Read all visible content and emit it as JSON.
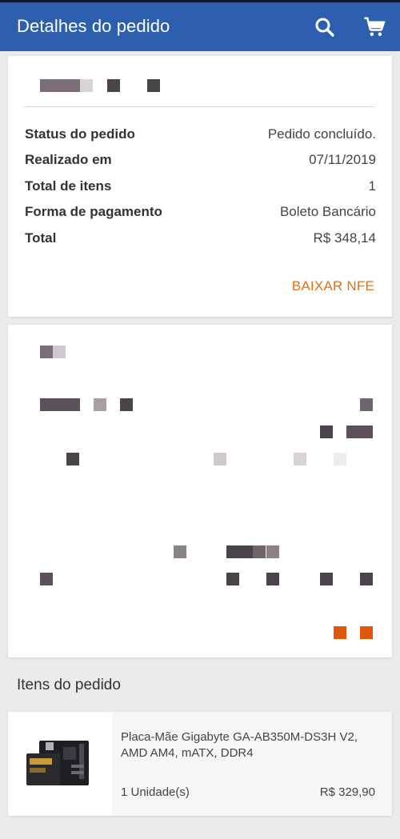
{
  "appbar": {
    "title": "Detalhes do pedido",
    "icons": [
      "search-icon",
      "cart-icon"
    ],
    "color": "#2d5fae"
  },
  "summary": {
    "rows": [
      {
        "label": "Status do pedido",
        "value": "Pedido concluído."
      },
      {
        "label": "Realizado em",
        "value": "07/11/2019"
      },
      {
        "label": "Total de itens",
        "value": "1"
      },
      {
        "label": "Forma de pagamento",
        "value": "Boleto Bancário"
      },
      {
        "label": "Total",
        "value": "R$ 348,14"
      }
    ],
    "nfe_button": "BAIXAR NFE",
    "accent": "#e0701a"
  },
  "items_section": {
    "title": "Itens do pedido",
    "items": [
      {
        "name": "Placa-Mãe Gigabyte GA-AB350M-DS3H V2, AMD AM4, mATX, DDR4",
        "quantity": "1 Unidade(s)",
        "price": "R$ 329,90"
      }
    ]
  }
}
